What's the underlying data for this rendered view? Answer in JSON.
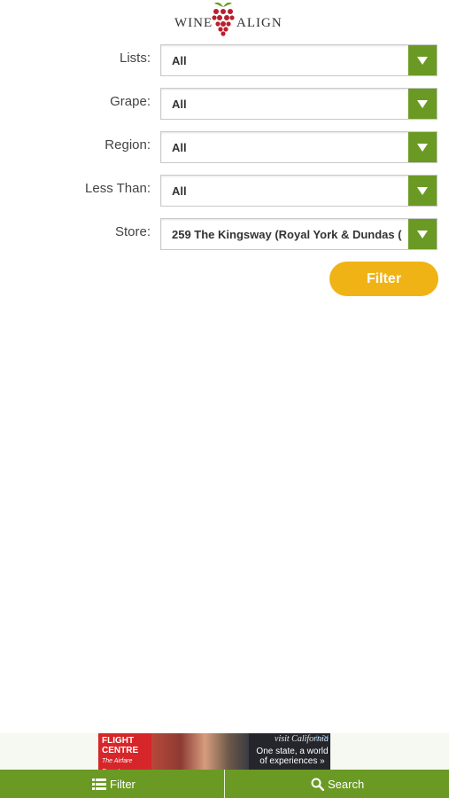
{
  "logo": {
    "left_text": "WINE",
    "right_text": "ALIGN"
  },
  "filters": [
    {
      "label": "Lists:",
      "value": "All"
    },
    {
      "label": "Grape:",
      "value": "All"
    },
    {
      "label": "Region:",
      "value": "All"
    },
    {
      "label": "Less Than:",
      "value": "All"
    },
    {
      "label": "Store:",
      "value": "259 The Kingsway (Royal York & Dundas ("
    }
  ],
  "filter_button": "Filter",
  "ad": {
    "logo_line1": "FLIGHT",
    "logo_line2": "CENTRE",
    "logo_tag": "The Airfare Experts",
    "brand": "visit California",
    "tagline": "One state, a world of experiences »"
  },
  "bottom_nav": {
    "filter_label": "Filter",
    "search_label": "Search"
  },
  "colors": {
    "accent_green": "#6a9a23",
    "button_gold": "#f0b315",
    "grape_red": "#b8202f"
  }
}
